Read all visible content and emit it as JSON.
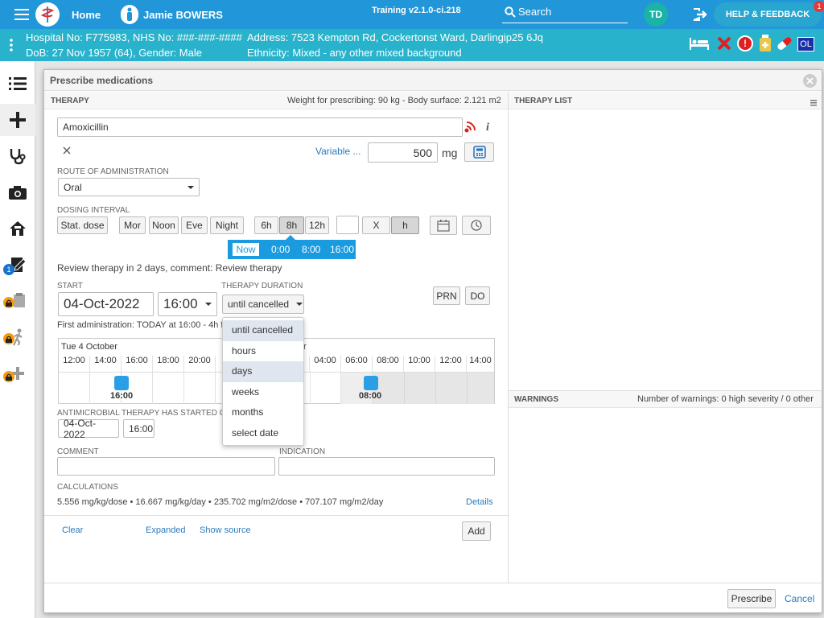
{
  "topbar": {
    "home_label": "Home",
    "patient_name": "Jamie BOWERS",
    "version": "Training v2.1.0-ci.218",
    "search_label": "Search",
    "user_initials": "TD",
    "help_label": "HELP & FEEDBACK",
    "help_badge": "1"
  },
  "patient": {
    "line1_left": "Hospital No: F775983, NHS No: ###-###-####",
    "line1_right": "Address: 7523 Kempton Rd, Cockertonst Ward, Darlingip25 6Jq",
    "line2_left": "DoB: 27 Nov 1957 (64), Gender: Male",
    "line2_right": "Ethnicity: Mixed - any other mixed background",
    "ol_badge": "OL"
  },
  "sidebar": {
    "badge_count": "1"
  },
  "modal": {
    "title": "Prescribe medications",
    "therapy_header": "THERAPY",
    "weight_info": "Weight for prescribing: 90 kg - Body surface: 2.121 m2",
    "therapy_list_header": "THERAPY LIST",
    "medication": "Amoxicillin",
    "variable_link": "Variable ...",
    "dose_value": "500",
    "dose_unit": "mg",
    "route_label": "ROUTE OF ADMINISTRATION",
    "route_value": "Oral",
    "dosing_label": "DOSING INTERVAL",
    "dosing_buttons": [
      "Stat. dose",
      "Mor",
      "Noon",
      "Eve",
      "Night",
      "6h",
      "8h",
      "12h"
    ],
    "x_label": "X",
    "h_label": "h",
    "times": [
      "Now",
      "0:00",
      "8:00",
      "16:00"
    ],
    "review_text": "Review therapy in 2 days, comment: Review therapy",
    "start_label": "START",
    "start_date": "04-Oct-2022",
    "start_time": "16:00",
    "duration_label": "THERAPY DURATION",
    "duration_value": "until cancelled",
    "prn_label": "PRN",
    "do_label": "DO",
    "first_admin": "First administration: TODAY at 16:00 - 4h f",
    "timeline": {
      "day_left": "Tue 4 October",
      "day_right_frag": "r",
      "hours": [
        "12:00",
        "14:00",
        "16:00",
        "18:00",
        "20:00",
        "2",
        "",
        "",
        "04:00",
        "06:00",
        "08:00",
        "10:00",
        "12:00",
        "14:00"
      ],
      "dose1": "16:00",
      "dose2": "08:00"
    },
    "duration_options": [
      "until cancelled",
      "hours",
      "days",
      "weeks",
      "months",
      "select date"
    ],
    "antimicrobial_label": "ANTIMICROBIAL THERAPY HAS STARTED ON",
    "anti_date": "04-Oct-2022",
    "anti_time": "16:00",
    "comment_label": "COMMENT",
    "indication_label": "INDICATION",
    "calc_label": "CALCULATIONS",
    "calc_text": "5.556 mg/kg/dose • 16.667 mg/kg/day • 235.702 mg/m2/dose • 707.107 mg/m2/day",
    "details_link": "Details",
    "clear_link": "Clear",
    "expanded_link": "Expanded",
    "show_source_link": "Show source",
    "add_button": "Add",
    "warnings_header": "WARNINGS",
    "warnings_count": "Number of warnings: 0 high severity / 0 other",
    "prescribe_button": "Prescribe",
    "cancel_link": "Cancel"
  },
  "colors": {
    "topbar": "#2196d9",
    "patientbar": "#29b2cc",
    "accent": "#2196d9",
    "badge_orange": "#f39c12",
    "alert_red": "#e02020"
  }
}
